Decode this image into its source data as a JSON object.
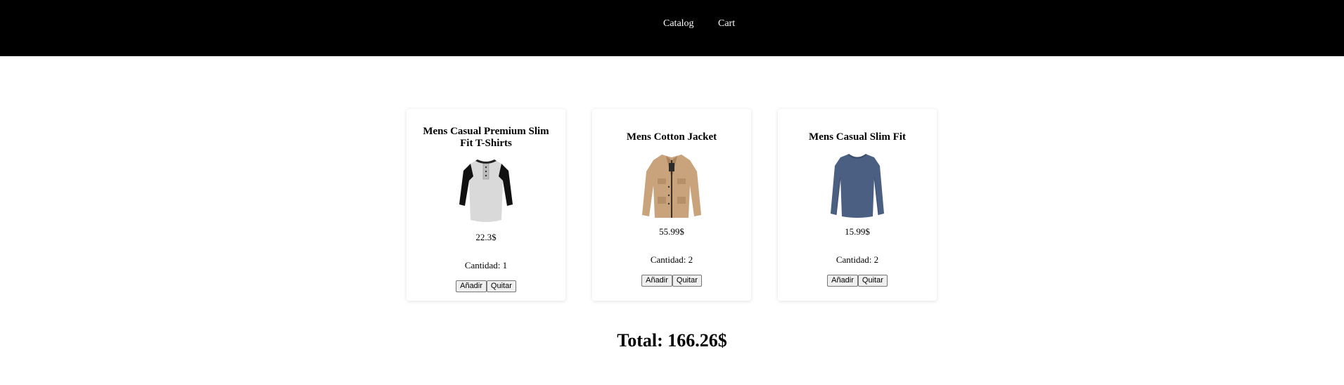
{
  "nav": {
    "catalog_label": "Catalog",
    "cart_label": "Cart"
  },
  "cart": {
    "items": [
      {
        "title": "Mens Casual Premium Slim Fit T-Shirts",
        "image_icon": "raglan-henley-shirt",
        "price": "22.3$",
        "quantity": "Cantidad: 1",
        "add_label": "Añadir",
        "remove_label": "Quitar"
      },
      {
        "title": "Mens Cotton Jacket",
        "image_icon": "beige-cotton-jacket",
        "price": "55.99$",
        "quantity": "Cantidad: 2",
        "add_label": "Añadir",
        "remove_label": "Quitar"
      },
      {
        "title": "Mens Casual Slim Fit",
        "image_icon": "blue-long-sleeve-tee",
        "price": "15.99$",
        "quantity": "Cantidad: 2",
        "add_label": "Añadir",
        "remove_label": "Quitar"
      }
    ],
    "total": "Total: 166.26$"
  },
  "colors": {
    "navbar_bg": "#000000",
    "nav_text": "#ffffff",
    "jacket": "#c9a37c",
    "blue_shirt": "#4a5f82"
  }
}
